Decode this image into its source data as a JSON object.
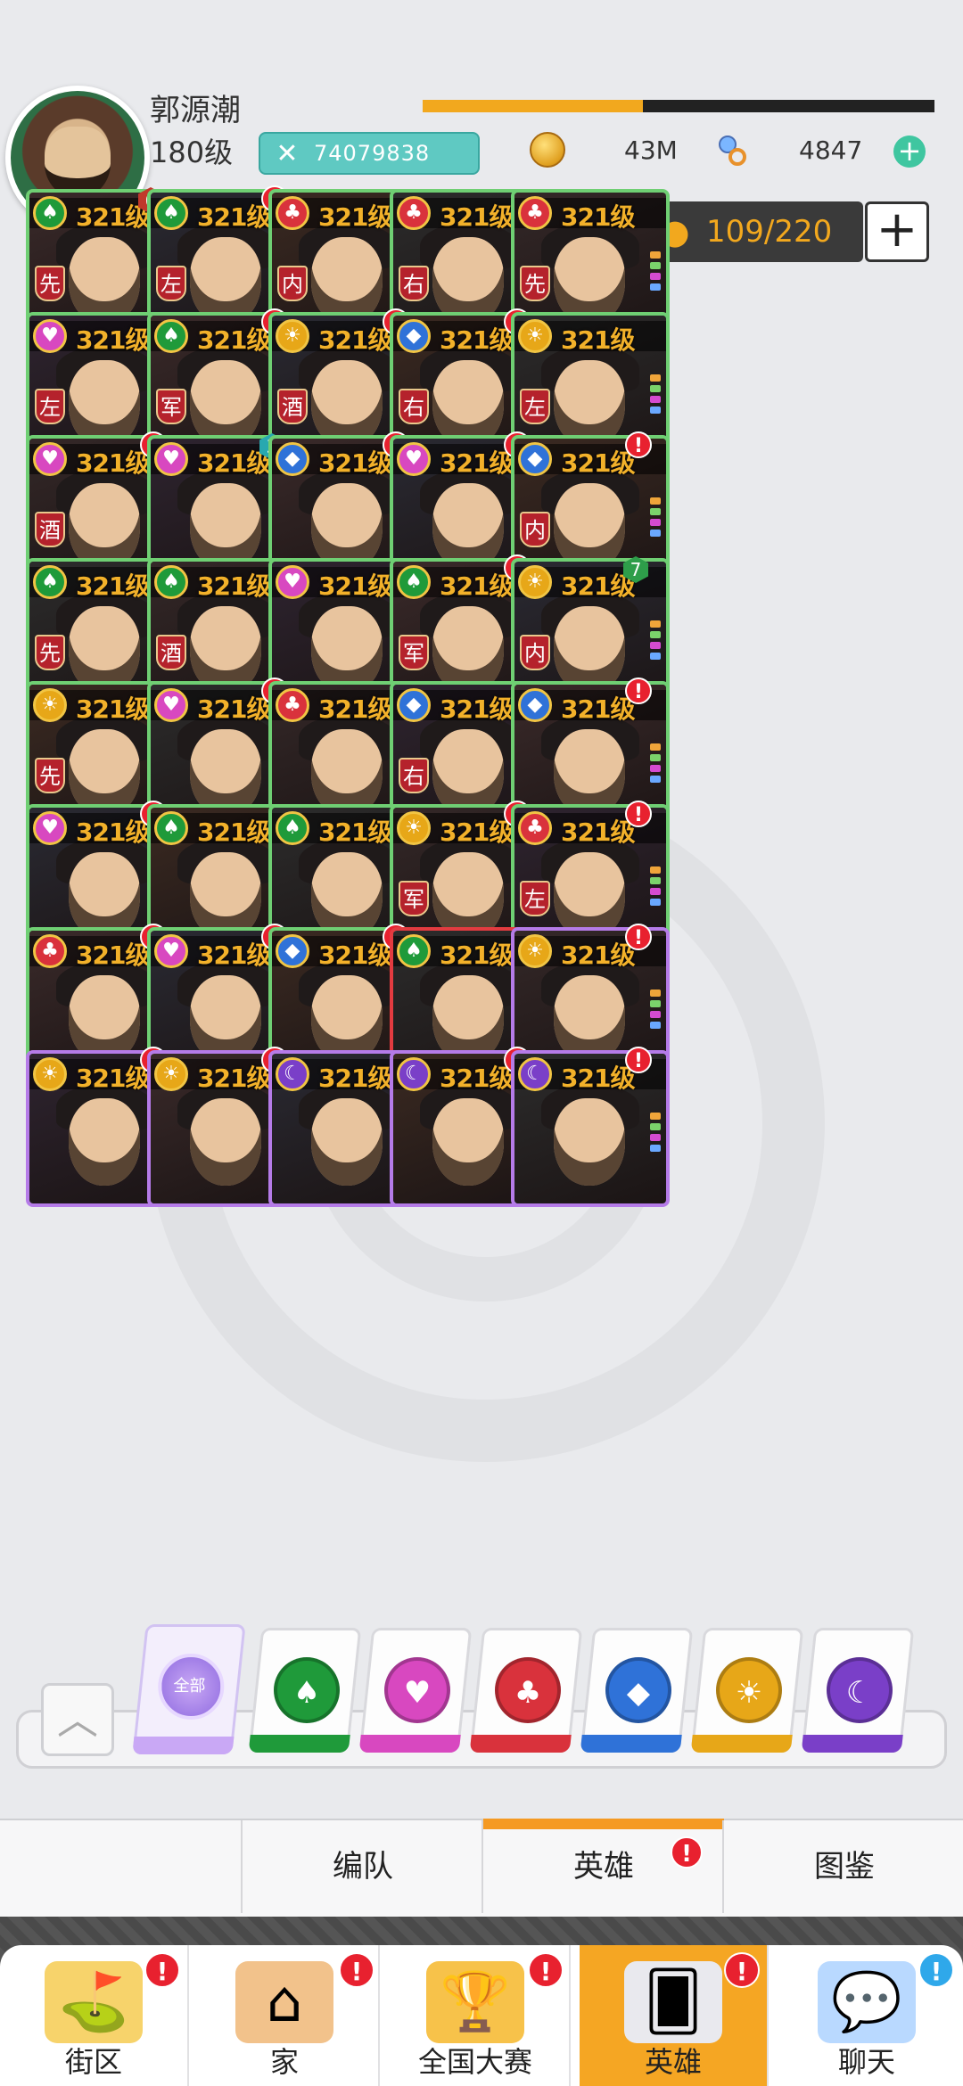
{
  "header": {
    "player_name": "郭源潮",
    "player_level": "180级",
    "combat_power": "74079838",
    "xp_progress": 0.43,
    "gold": "43M",
    "gems": "4847",
    "capacity": "109/220"
  },
  "level_label": "321级",
  "heroes": [
    {
      "suit": "spade",
      "rank": "先",
      "stars": 5,
      "badge": "6"
    },
    {
      "suit": "spade",
      "rank": "左",
      "stars": 5,
      "badge": "!"
    },
    {
      "suit": "club",
      "rank": "内",
      "stars": 5,
      "badge": ""
    },
    {
      "suit": "club",
      "rank": "右",
      "stars": 5,
      "badge": ""
    },
    {
      "suit": "club",
      "rank": "先",
      "stars": 5,
      "badge": ""
    },
    {
      "suit": "heart",
      "rank": "左",
      "stars": 5,
      "badge": ""
    },
    {
      "suit": "spade",
      "rank": "军",
      "stars": 5,
      "badge": "!"
    },
    {
      "suit": "sun",
      "rank": "酒",
      "stars": 5,
      "badge": "!"
    },
    {
      "suit": "diamond",
      "rank": "右",
      "stars": 5,
      "badge": "!"
    },
    {
      "suit": "sun",
      "rank": "左",
      "stars": 5,
      "badge": ""
    },
    {
      "suit": "heart",
      "rank": "酒",
      "stars": 5,
      "badge": "!"
    },
    {
      "suit": "heart",
      "rank": "",
      "stars": 4,
      "badge": "3"
    },
    {
      "suit": "diamond",
      "rank": "",
      "stars": 4,
      "badge": "!"
    },
    {
      "suit": "heart",
      "rank": "",
      "stars": 4,
      "badge": "!"
    },
    {
      "suit": "diamond",
      "rank": "内",
      "stars": 3,
      "badge": "!"
    },
    {
      "suit": "spade",
      "rank": "先",
      "stars": 3,
      "badge": ""
    },
    {
      "suit": "spade",
      "rank": "酒",
      "stars": 3,
      "badge": ""
    },
    {
      "suit": "heart",
      "rank": "",
      "stars": 2,
      "badge": ""
    },
    {
      "suit": "spade",
      "rank": "军",
      "stars": 2,
      "badge": "!"
    },
    {
      "suit": "sun",
      "rank": "内",
      "stars": 1,
      "badge": "7"
    },
    {
      "suit": "sun",
      "rank": "先",
      "stars": 1,
      "badge": ""
    },
    {
      "suit": "heart",
      "rank": "",
      "stars": 1,
      "badge": "!"
    },
    {
      "suit": "club",
      "rank": "",
      "stars": 1,
      "badge": ""
    },
    {
      "suit": "diamond",
      "rank": "右",
      "stars": 1,
      "badge": ""
    },
    {
      "suit": "diamond",
      "rank": "",
      "stars": 1,
      "badge": "!"
    },
    {
      "suit": "heart",
      "rank": "",
      "stars": 1,
      "badge": "!"
    },
    {
      "suit": "spade",
      "rank": "",
      "stars": 1,
      "badge": ""
    },
    {
      "suit": "spade",
      "rank": "",
      "stars": 1,
      "badge": ""
    },
    {
      "suit": "sun",
      "rank": "军",
      "stars": 0,
      "badge": "!"
    },
    {
      "suit": "club",
      "rank": "左",
      "stars": 0,
      "badge": "!"
    },
    {
      "suit": "club",
      "rank": "",
      "stars": 0,
      "badge": "!"
    },
    {
      "suit": "heart",
      "rank": "",
      "stars": 0,
      "badge": "!"
    },
    {
      "suit": "diamond",
      "rank": "",
      "stars": 0,
      "badge": "!"
    },
    {
      "suit": "spade",
      "rank": "",
      "stars": 0,
      "badge": ""
    },
    {
      "suit": "sun",
      "rank": "",
      "stars": 0,
      "badge": "!"
    },
    {
      "suit": "sun",
      "rank": "",
      "stars": 0,
      "badge": "!"
    },
    {
      "suit": "sun",
      "rank": "",
      "stars": 0,
      "badge": "!"
    },
    {
      "suit": "moon",
      "rank": "",
      "stars": 0,
      "badge": ""
    },
    {
      "suit": "moon",
      "rank": "",
      "stars": 0,
      "badge": "!"
    },
    {
      "suit": "moon",
      "rank": "",
      "stars": 0,
      "badge": "!"
    }
  ],
  "suit_colors": {
    "spade": "#1f9a3a",
    "heart": "#d848c0",
    "club": "#d9323c",
    "diamond": "#2f72d8",
    "sun": "#e7a718",
    "moon": "#7a3fc8"
  },
  "filters": {
    "all_label": "全部",
    "items": [
      "spade",
      "heart",
      "club",
      "diamond",
      "sun",
      "moon"
    ]
  },
  "subtabs": [
    "编队",
    "英雄",
    "图鉴"
  ],
  "nav": [
    "街区",
    "家",
    "全国大赛",
    "英雄",
    "聊天"
  ]
}
